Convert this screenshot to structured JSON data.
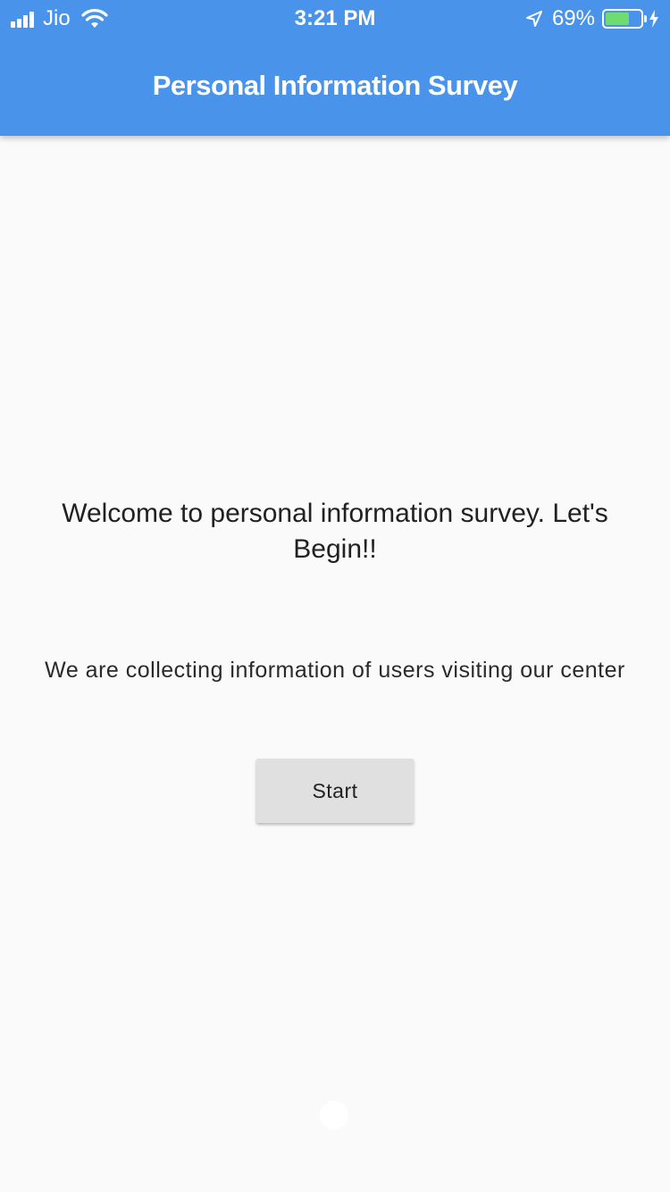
{
  "status_bar": {
    "carrier": "Jio",
    "time": "3:21 PM",
    "battery_percent": "69%",
    "battery_level": 0.69,
    "icons": [
      "signal-bars-icon",
      "wifi-icon",
      "location-arrow-icon",
      "battery-icon",
      "charging-bolt-icon"
    ]
  },
  "app_bar": {
    "title": "Personal Information Survey"
  },
  "main": {
    "welcome_text": "Welcome to personal information  survey. Let's Begin!!",
    "subtitle_text": "We are collecting information of users visiting our center",
    "start_label": "Start"
  },
  "colors": {
    "app_bar": "#4a93ea",
    "background": "#fafafa",
    "button": "#e0e0e0",
    "battery_fill": "#6fdc6f"
  }
}
